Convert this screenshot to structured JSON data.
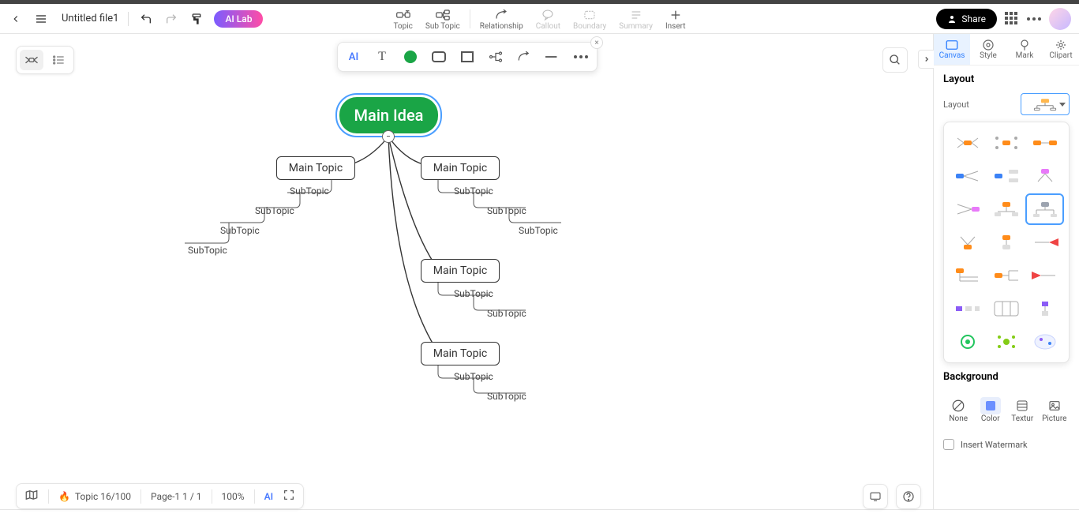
{
  "header": {
    "filename": "Untitled file1",
    "ai_lab": "AI Lab",
    "share": "Share",
    "toolbar": [
      {
        "id": "topic",
        "label": "Topic"
      },
      {
        "id": "subtopic",
        "label": "Sub Topic"
      },
      {
        "id": "relationship",
        "label": "Relationship"
      },
      {
        "id": "callout",
        "label": "Callout",
        "disabled": true
      },
      {
        "id": "boundary",
        "label": "Boundary",
        "disabled": true
      },
      {
        "id": "summary",
        "label": "Summary",
        "disabled": true
      },
      {
        "id": "insert",
        "label": "Insert"
      }
    ]
  },
  "mindmap": {
    "root": "Main Idea",
    "branches": [
      {
        "title": "Main Topic",
        "sub": [
          "SubTopic",
          "SubTopic",
          "SubTopic",
          "SubTopic"
        ],
        "side": "left"
      },
      {
        "title": "Main Topic",
        "sub": [
          "SubTopic",
          "SubTopic",
          "SubTopic"
        ],
        "side": "right"
      },
      {
        "title": "Main Topic",
        "sub": [
          "SubTopic",
          "SubTopic"
        ],
        "side": "down",
        "idx": 0
      },
      {
        "title": "Main Topic",
        "sub": [
          "SubTopic",
          "SubTopic"
        ],
        "side": "down",
        "idx": 1
      }
    ]
  },
  "right_panel": {
    "tabs": [
      "Canvas",
      "Style",
      "Mark",
      "Clipart"
    ],
    "active_tab": 0,
    "section": "Layout",
    "layout_label": "Layout",
    "background_section": "Background",
    "bg_tabs": [
      "None",
      "Color",
      "Textur",
      "Picture"
    ],
    "watermark": "Insert Watermark"
  },
  "bottom": {
    "topic_count": "Topic 16/100",
    "page": "Page-1  1 / 1",
    "zoom": "100%"
  }
}
